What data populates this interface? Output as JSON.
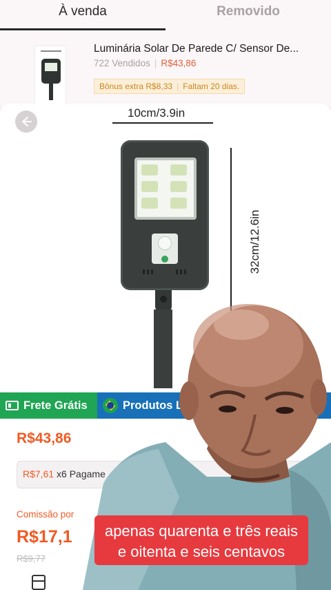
{
  "tabs": [
    {
      "label": "À venda",
      "active": true
    },
    {
      "label": "Removido",
      "active": false
    }
  ],
  "product": {
    "title": "Luminária Solar De Parede C/ Sensor De...",
    "sold": "722 Vendidos",
    "price": "R$43,86",
    "bonus": "Bônus extra R$8,33",
    "remaining": "Faltam 20 dias."
  },
  "image": {
    "width_label": "10cm/3.9in",
    "height_label": "32cm/12.6in"
  },
  "badges": {
    "shipping": "Frete Grátis",
    "local": "Produtos Lo"
  },
  "pricing": {
    "price": "R$43,86",
    "installment_price": "R$7,61",
    "installment_text": " x6 Pagame",
    "commission_label": "Comissão por",
    "commission_value": "R$17,1",
    "old_value": "R$9,77"
  },
  "caption": "apenas quarenta e três reais e oitenta e seis centavos",
  "colors": {
    "accent": "#f05a24",
    "green_badge": "#1fa553",
    "blue_badge": "#1770b8",
    "caption_bg": "#e63a3f"
  }
}
